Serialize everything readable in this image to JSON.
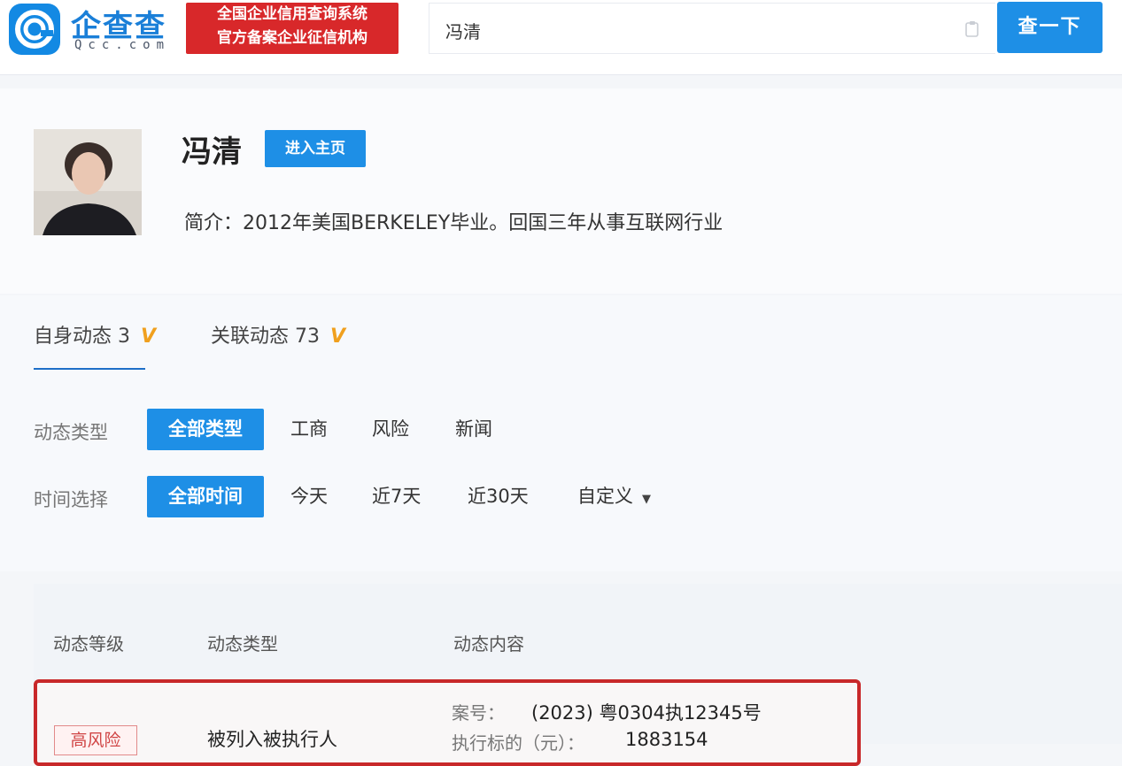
{
  "header": {
    "logo_name": "企查查",
    "logo_domain": "Qcc.com",
    "cert_line1": "全国企业信用查询系统",
    "cert_line2": "官方备案企业征信机构",
    "search_value": "冯清",
    "search_button": "查一下",
    "brand_color": "#1e8fe6"
  },
  "profile": {
    "name": "冯清",
    "home_button": "进入主页",
    "intro": "简介：2012年美国BERKELEY毕业。回国三年从事互联网行业"
  },
  "activity": {
    "tabs": [
      {
        "label": "自身动态 3",
        "vip": "V"
      },
      {
        "label": "关联动态 73",
        "vip": "V"
      }
    ],
    "type_filter": {
      "label": "动态类型",
      "options": [
        "全部类型",
        "工商",
        "风险",
        "新闻"
      ],
      "selected": "全部类型"
    },
    "time_filter": {
      "label": "时间选择",
      "options": [
        "全部时间",
        "今天",
        "近7天",
        "近30天",
        "自定义"
      ],
      "selected": "全部时间"
    }
  },
  "table": {
    "columns": [
      "动态等级",
      "动态类型",
      "动态内容"
    ],
    "rows": [
      {
        "level": "高风险",
        "type": "被列入被执行人",
        "case_label": "案号：",
        "case_value": "(2023) 粤0304执12345号",
        "amount_label": "执行标的（元）：",
        "amount_value": "1883154"
      }
    ],
    "highlight_color": "#c8282a"
  }
}
